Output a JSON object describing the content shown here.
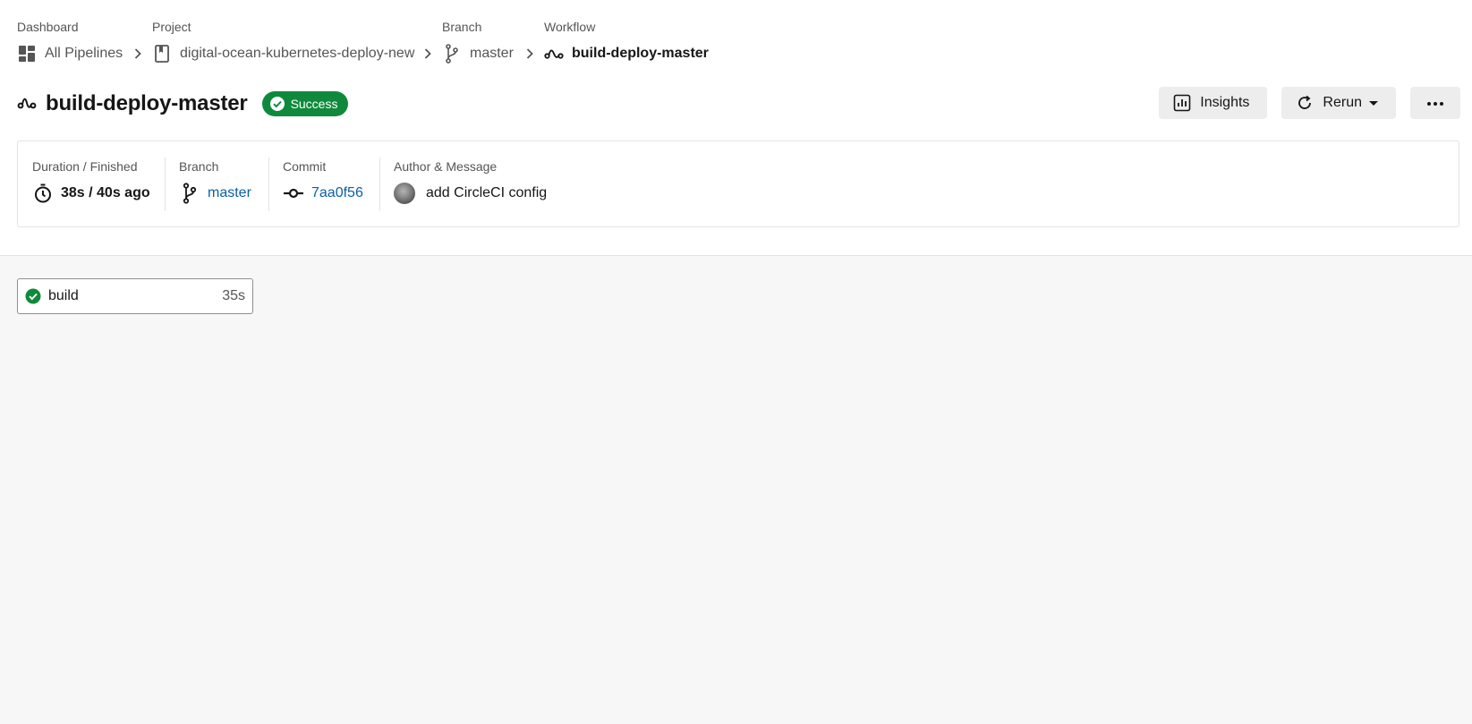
{
  "breadcrumb": {
    "dashboard": {
      "heading": "Dashboard",
      "label": "All Pipelines",
      "icon": "dashboard-icon"
    },
    "project": {
      "heading": "Project",
      "label": "digital-ocean-kubernetes-deploy-new",
      "icon": "project-book-icon"
    },
    "branch": {
      "heading": "Branch",
      "label": "master",
      "icon": "branch-icon"
    },
    "workflow": {
      "heading": "Workflow",
      "label": "build-deploy-master",
      "icon": "workflow-icon"
    }
  },
  "header": {
    "title": "build-deploy-master",
    "status": "Success",
    "status_color": "#0f8a3c"
  },
  "actions": {
    "insights_label": "Insights",
    "rerun_label": "Rerun"
  },
  "meta": {
    "duration_label": "Duration / Finished",
    "duration_value": "38s / 40s ago",
    "branch_label": "Branch",
    "branch_value": "master",
    "commit_label": "Commit",
    "commit_value": "7aa0f56",
    "author_label": "Author & Message",
    "message": "add CircleCI config",
    "link_color": "#0b5fa5"
  },
  "jobs": [
    {
      "name": "build",
      "duration": "35s",
      "status": "success"
    }
  ]
}
